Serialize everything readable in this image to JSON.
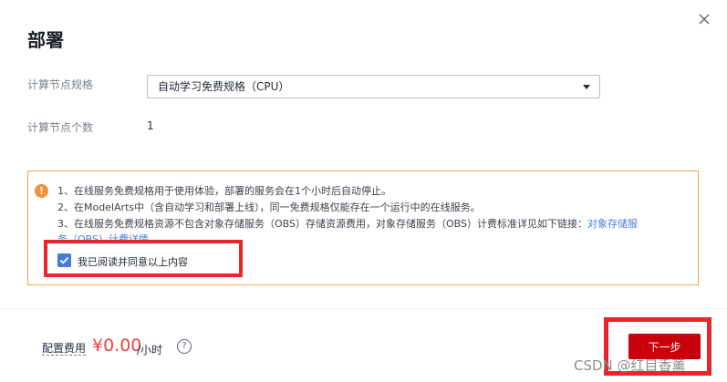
{
  "dialog": {
    "title": "部署",
    "close_icon": "close-icon"
  },
  "form": {
    "spec_label": "计算节点规格",
    "spec_value": "自动学习免费规格（CPU）",
    "count_label": "计算节点个数",
    "count_value": "1"
  },
  "notice": {
    "icon": "warning-icon",
    "line1": "1、在线服务免费规格用于使用体验，部署的服务会在1个小时后自动停止。",
    "line2": "2、在ModelArts中（含自动学习和部署上线），同一免费规格仅能存在一个运行中的在线服务。",
    "line3_text": "3、在线服务免费规格资源不包含对象存储服务（OBS）存储资源费用，对象存储服务（OBS）计费标准详见如下链接：",
    "line3_link_part1": "对象存储服",
    "line3_link_part2": "务（OBS）计费详情",
    "agree_label": "我已阅读并同意以上内容",
    "agree_checked": true
  },
  "footer": {
    "fee_label": "配置费用",
    "price": "¥0.00",
    "unit": "/小时",
    "help_icon": "help-icon",
    "next_label": "下一步"
  },
  "watermark": "CSDN @红目香薰",
  "colors": {
    "primary_button": "#c7000b",
    "price": "#e64545",
    "checkbox": "#4b79d6",
    "notice_border": "#f2a64f",
    "highlight_box": "#e6262a",
    "link": "#4a7fd8"
  }
}
